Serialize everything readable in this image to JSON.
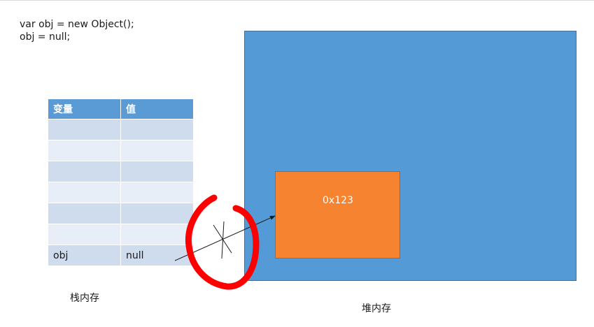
{
  "code": {
    "line1": "var obj = new Object();",
    "line2": "obj = null;"
  },
  "stack_table": {
    "headers": [
      "变量",
      "值"
    ],
    "rows": [
      [
        "",
        ""
      ],
      [
        "",
        ""
      ],
      [
        "",
        ""
      ],
      [
        "",
        ""
      ],
      [
        "",
        ""
      ],
      [
        "",
        ""
      ],
      [
        "obj",
        "null"
      ]
    ]
  },
  "stack_label": "栈内存",
  "heap": {
    "label": "堆内存",
    "object_address": "0x123"
  },
  "colors": {
    "table_header": "#5b9bd5",
    "table_row_dark": "#cfdcee",
    "table_row_light": "#e8eef7",
    "heap": "#549ad6",
    "object": "#f5832f",
    "annotation": "#ff0000"
  }
}
